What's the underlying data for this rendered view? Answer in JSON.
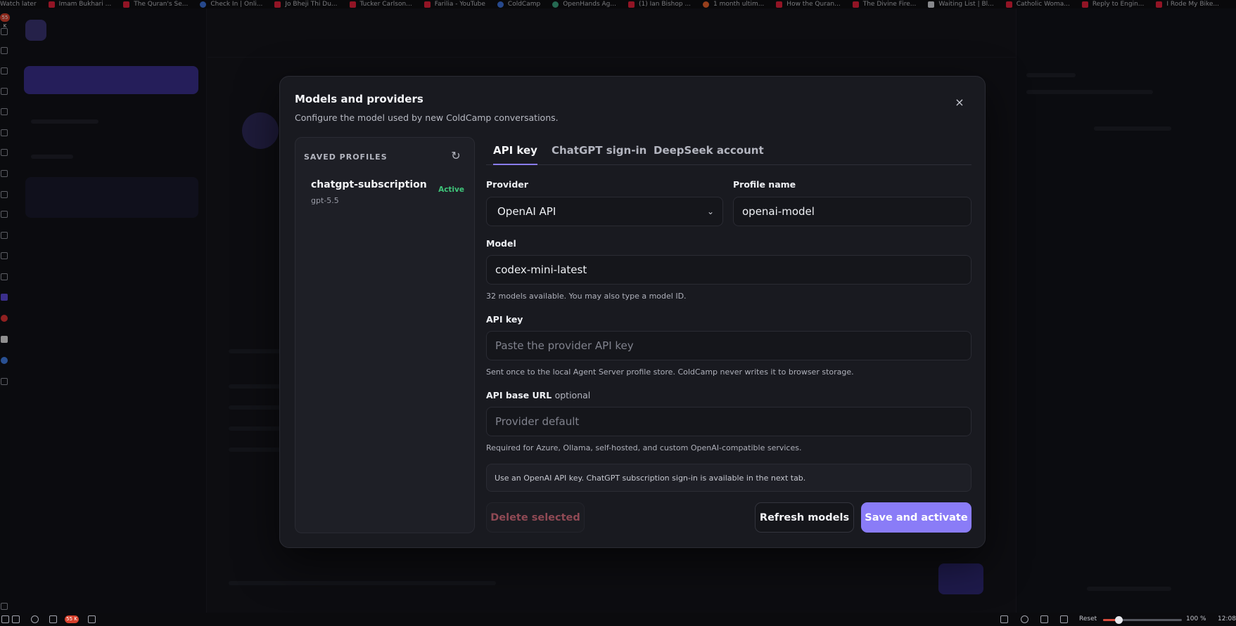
{
  "bookmarks": [
    {
      "label": "Watch later",
      "icon": "none"
    },
    {
      "label": "Imam Bukhari ...",
      "icon": "youtube"
    },
    {
      "label": "The Quran's Se...",
      "icon": "youtube"
    },
    {
      "label": "Check In | Onli...",
      "icon": "globe"
    },
    {
      "label": "Jo Bheji Thi Du...",
      "icon": "youtube"
    },
    {
      "label": "Tucker Carlson...",
      "icon": "youtube"
    },
    {
      "label": "Farilia - YouTube",
      "icon": "youtube"
    },
    {
      "label": "ColdCamp",
      "icon": "app"
    },
    {
      "label": "OpenHands Ag...",
      "icon": "openhands"
    },
    {
      "label": "(1) Ian Bishop ...",
      "icon": "youtube"
    },
    {
      "label": "1 month ultim...",
      "icon": "brave"
    },
    {
      "label": "How the Quran...",
      "icon": "youtube"
    },
    {
      "label": "The Divine Fire...",
      "icon": "youtube"
    },
    {
      "label": "Waiting List | Bl...",
      "icon": "page"
    },
    {
      "label": "Catholic Woma...",
      "icon": "youtube"
    },
    {
      "label": "Reply to Engin...",
      "icon": "youtube"
    },
    {
      "label": "I Rode My Bike...",
      "icon": "youtube"
    }
  ],
  "rail": {
    "badge": "55 K"
  },
  "modal": {
    "title": "Models and providers",
    "subtitle": "Configure the model used by new ColdCamp conversations.",
    "close_icon": "×",
    "profiles": {
      "heading": "SAVED PROFILES",
      "refresh_icon": "↻",
      "items": [
        {
          "name": "chatgpt-subscription",
          "model": "gpt-5.5",
          "status": "Active"
        }
      ]
    },
    "tabs": [
      {
        "label": "API key",
        "active": true
      },
      {
        "label": "ChatGPT sign-in",
        "active": false
      },
      {
        "label": "DeepSeek account",
        "active": false
      }
    ],
    "form": {
      "provider_label": "Provider",
      "provider_value": "OpenAI API",
      "provider_chevron": "⌄",
      "profile_name_label": "Profile name",
      "profile_name_value": "openai-model",
      "model_label": "Model",
      "model_value": "codex-mini-latest",
      "model_hint": "32 models available. You may also type a model ID.",
      "api_key_label": "API key",
      "api_key_placeholder": "Paste the provider API key",
      "api_key_hint": "Sent once to the local Agent Server profile store. ColdCamp never writes it to browser storage.",
      "base_url_label": "API base URL",
      "base_url_optional": "optional",
      "base_url_placeholder": "Provider default",
      "base_url_hint": "Required for Azure, Ollama, self-hosted, and custom OpenAI-compatible services.",
      "notice": "Use an OpenAI API key. ChatGPT subscription sign-in is available in the next tab."
    },
    "buttons": {
      "delete": "Delete selected",
      "refresh": "Refresh models",
      "save": "Save and activate"
    }
  },
  "taskbar": {
    "badge": "55 K",
    "reset": "Reset",
    "zoom": "100 %",
    "zoom_level": 0.2,
    "time": "12:08"
  },
  "colors": {
    "accent": "#8a7cf7",
    "active_status": "#3fc57a",
    "danger_text": "#8f4954"
  }
}
